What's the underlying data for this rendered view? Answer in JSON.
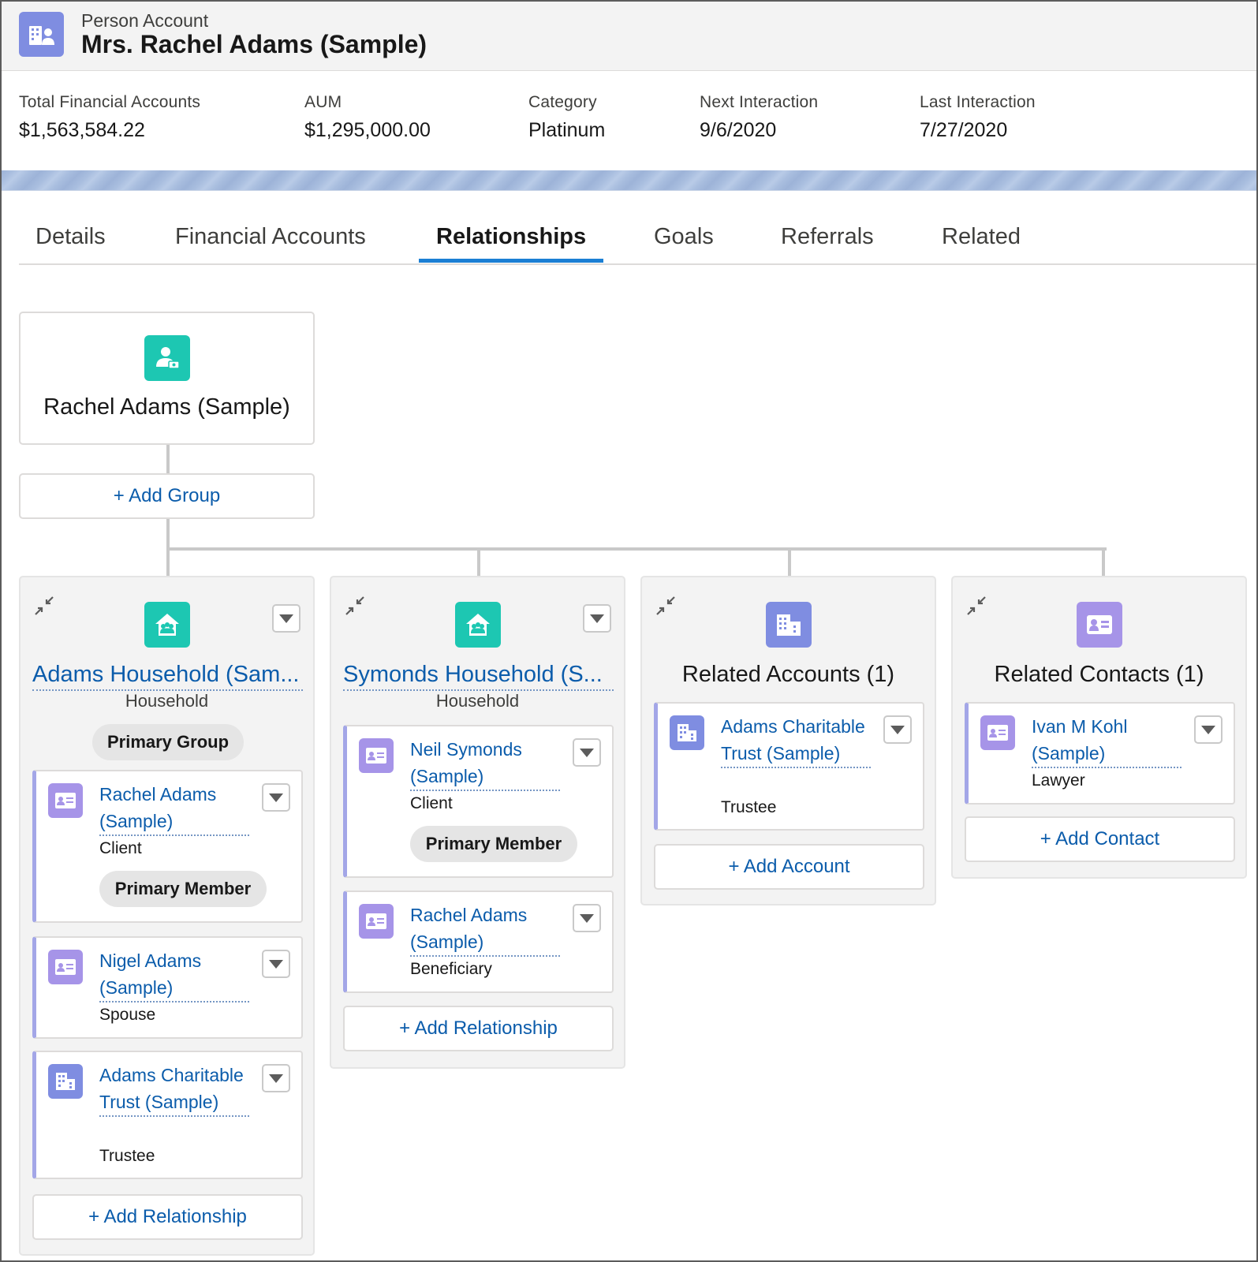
{
  "header": {
    "object_type": "Person Account",
    "title": "Mrs. Rachel Adams (Sample)"
  },
  "highlights": [
    {
      "label": "Total Financial Accounts",
      "value": "$1,563,584.22"
    },
    {
      "label": "AUM",
      "value": "$1,295,000.00"
    },
    {
      "label": "Category",
      "value": "Platinum"
    },
    {
      "label": "Next Interaction",
      "value": "9/6/2020"
    },
    {
      "label": "Last Interaction",
      "value": "7/27/2020"
    }
  ],
  "tabs": [
    {
      "label": "Details",
      "active": false
    },
    {
      "label": "Financial Accounts",
      "active": false
    },
    {
      "label": "Relationships",
      "active": true
    },
    {
      "label": "Goals",
      "active": false
    },
    {
      "label": "Referrals",
      "active": false
    },
    {
      "label": "Related",
      "active": false
    }
  ],
  "root": {
    "name": "Rachel Adams (Sample)",
    "add_group_label": "+ Add Group"
  },
  "columns": [
    {
      "title": "Adams Household (Sam...",
      "subtitle": "Household",
      "badge": "Primary Group",
      "members": [
        {
          "name": "Rachel Adams (Sample)",
          "role": "Client",
          "pill": "Primary Member"
        },
        {
          "name": "Nigel Adams (Sample)",
          "role": "Spouse"
        },
        {
          "name": "Adams Charitable Trust (Sample)",
          "role": "Trustee"
        }
      ],
      "add_label": "+ Add Relationship"
    },
    {
      "title": "Symonds Household (S...",
      "subtitle": "Household",
      "members": [
        {
          "name": "Neil Symonds (Sample)",
          "role": "Client",
          "pill": "Primary Member"
        },
        {
          "name": "Rachel Adams (Sample)",
          "role": "Beneficiary"
        }
      ],
      "add_label": "+ Add Relationship"
    },
    {
      "title": "Related Accounts (1)",
      "members": [
        {
          "name": "Adams Charitable Trust (Sample)",
          "role": "Trustee"
        }
      ],
      "add_label": "+ Add Account"
    },
    {
      "title": "Related Contacts (1)",
      "members": [
        {
          "name": "Ivan M Kohl (Sample)",
          "role": "Lawyer"
        }
      ],
      "add_label": "+ Add Contact"
    }
  ],
  "icons": {
    "header": "person-account-icon",
    "root": "person-icon",
    "household": "household-icon",
    "account": "building-icon",
    "contact": "contact-card-icon",
    "collapse": "collapse-icon",
    "menu": "chevron-down-icon"
  },
  "colors": {
    "link": "#0b5cab",
    "tab_active_underline": "#1b7fd4",
    "teal_icon": "#1dc7b2",
    "purple_icon": "#8c7ede",
    "account_icon": "#7f8de1"
  }
}
